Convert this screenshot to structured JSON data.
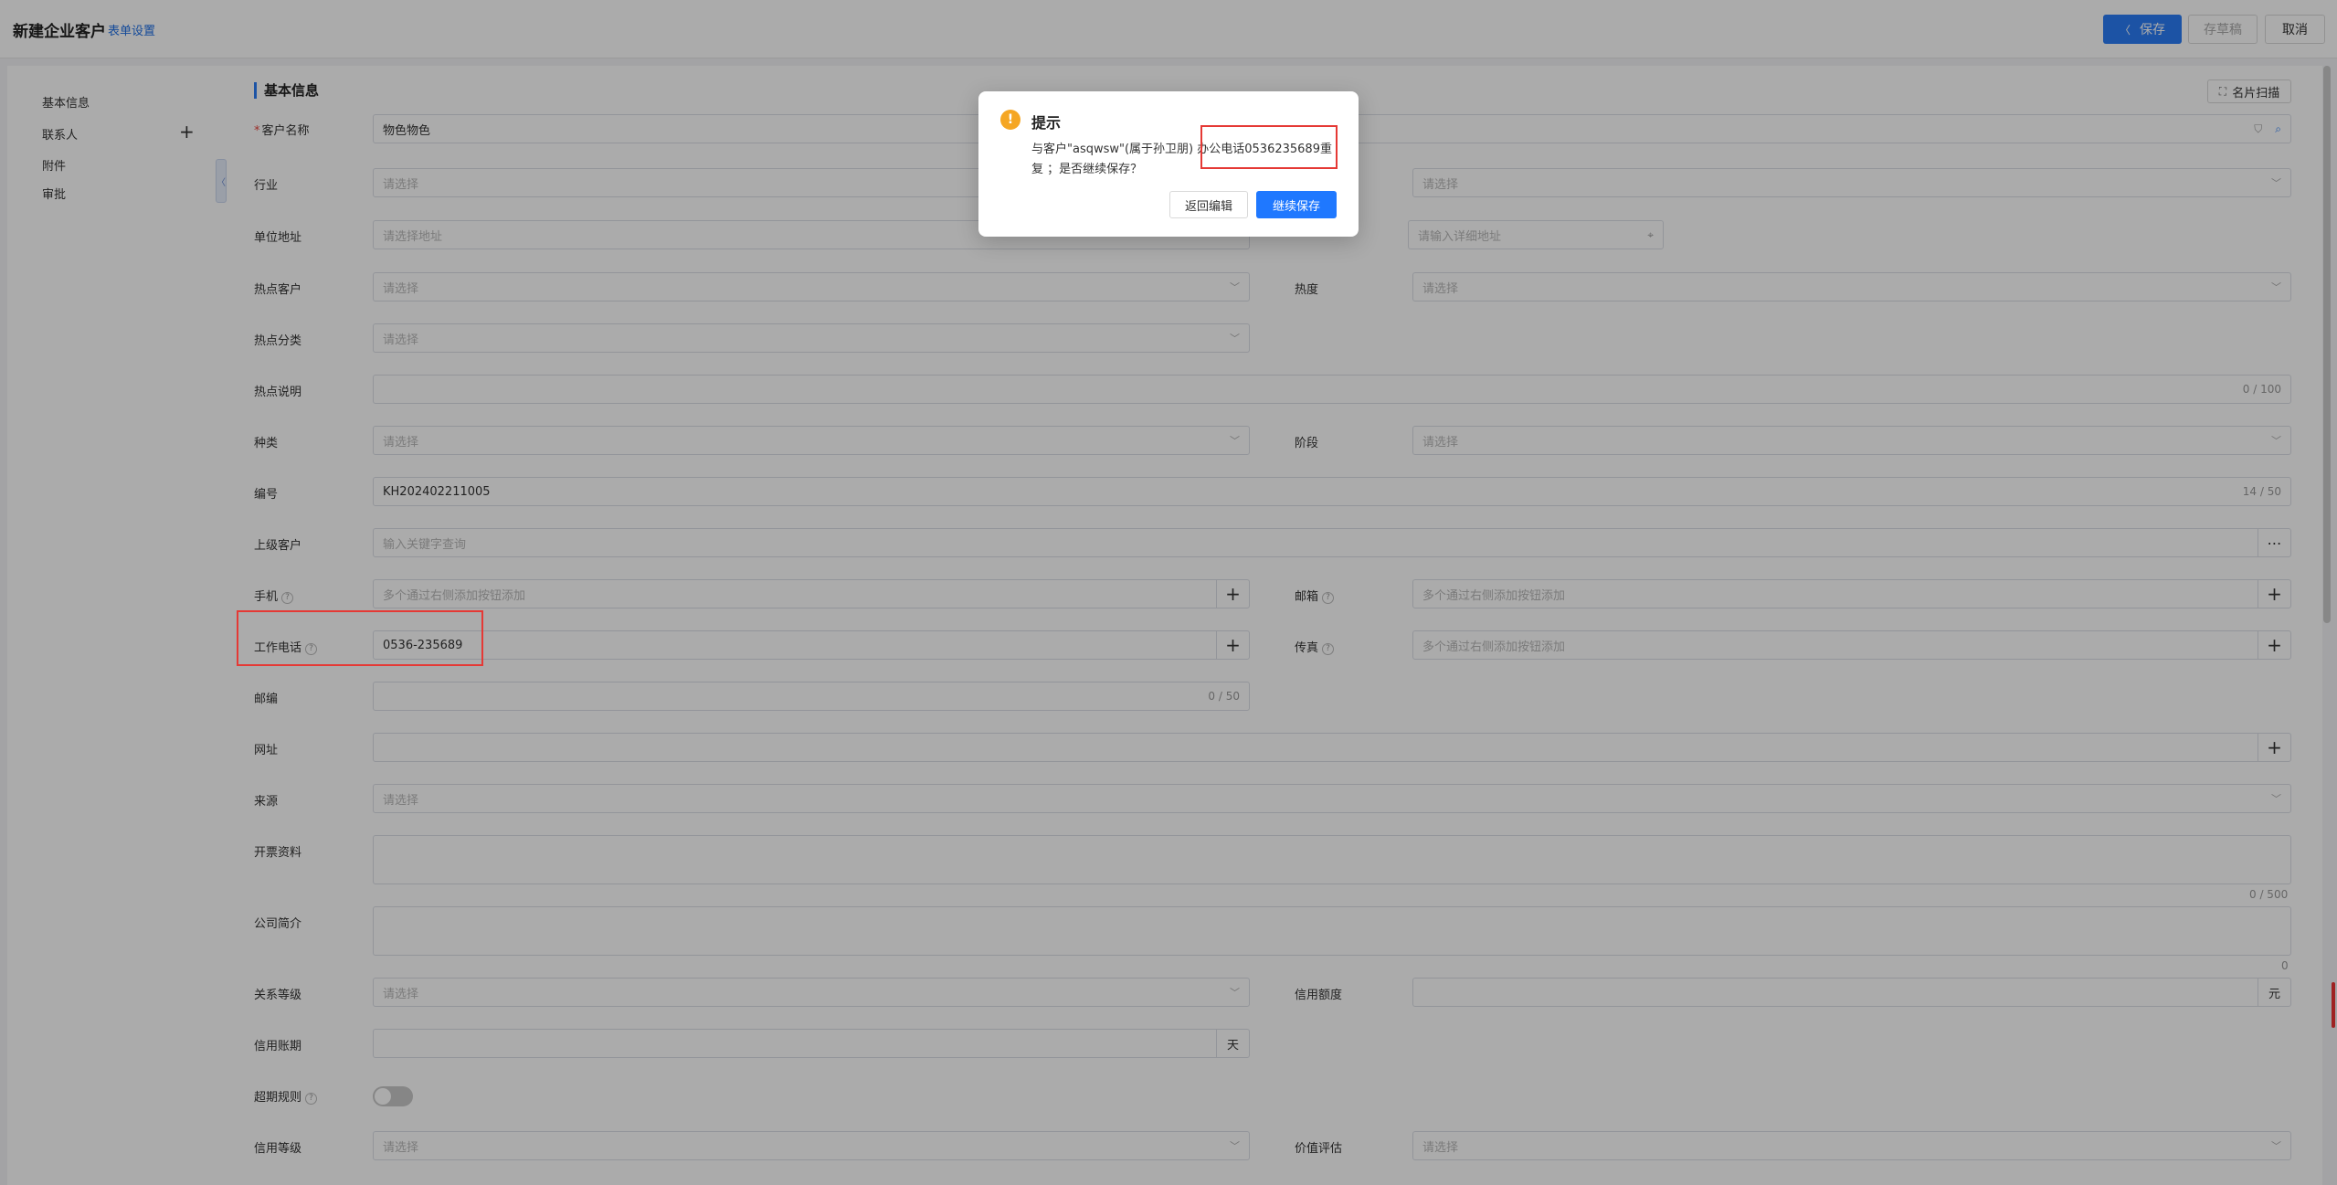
{
  "header": {
    "title": "新建企业客户",
    "form_settings": "表单设置",
    "save": "保存",
    "draft": "存草稿",
    "cancel": "取消"
  },
  "sidebar": {
    "items": [
      {
        "label": "基本信息"
      },
      {
        "label": "联系人"
      },
      {
        "label": "附件"
      },
      {
        "label": "审批"
      }
    ]
  },
  "section": {
    "title": "基本信息",
    "card_scan": "名片扫描"
  },
  "form": {
    "customer_name": {
      "label": "客户名称",
      "value": "物色物色"
    },
    "industry": {
      "label": "行业",
      "placeholder": "请选择"
    },
    "address": {
      "label": "单位地址",
      "placeholder": "请选择地址",
      "detail_placeholder": "请输入详细地址"
    },
    "hot_customer": {
      "label": "热点客户",
      "placeholder": "请选择"
    },
    "heat": {
      "label": "热度",
      "placeholder": "请选择"
    },
    "hot_category": {
      "label": "热点分类",
      "placeholder": "请选择"
    },
    "hot_desc": {
      "label": "热点说明",
      "counter": "0 / 100"
    },
    "kind": {
      "label": "种类",
      "placeholder": "请选择"
    },
    "stage": {
      "label": "阶段",
      "placeholder": "请选择"
    },
    "code": {
      "label": "编号",
      "value": "KH202402211005",
      "counter": "14 / 50"
    },
    "parent": {
      "label": "上级客户",
      "placeholder": "输入关键字查询"
    },
    "mobile": {
      "label": "手机",
      "placeholder": "多个通过右侧添加按钮添加"
    },
    "email": {
      "label": "邮箱",
      "placeholder": "多个通过右侧添加按钮添加"
    },
    "work_phone": {
      "label": "工作电话",
      "value": "0536-235689"
    },
    "fax": {
      "label": "传真",
      "placeholder": "多个通过右侧添加按钮添加"
    },
    "postcode": {
      "label": "邮编",
      "counter": "0 / 50"
    },
    "website": {
      "label": "网址"
    },
    "source": {
      "label": "来源",
      "placeholder": "请选择"
    },
    "invoice": {
      "label": "开票资料",
      "counter": "0 / 500"
    },
    "intro": {
      "label": "公司简介",
      "counter": "0"
    },
    "relation_level": {
      "label": "关系等级",
      "placeholder": "请选择"
    },
    "credit_limit": {
      "label": "信用额度",
      "unit": "元"
    },
    "credit_period": {
      "label": "信用账期",
      "unit": "天"
    },
    "overdue_rule": {
      "label": "超期规则"
    },
    "credit_level": {
      "label": "信用等级",
      "placeholder": "请选择"
    },
    "value_eval": {
      "label": "价值评估",
      "placeholder": "请选择"
    }
  },
  "dialog": {
    "title": "提示",
    "message_line1": "与客户\"asqwsw\"(属于孙卫朋) 办公电话0536235689重",
    "message_line2": "复 ；是否继续保存？",
    "back_label": "返回编辑",
    "continue_label": "继续保存"
  },
  "colors": {
    "accent": "#2b7cf6",
    "highlight": "#e53935",
    "warning": "#f5a623"
  }
}
